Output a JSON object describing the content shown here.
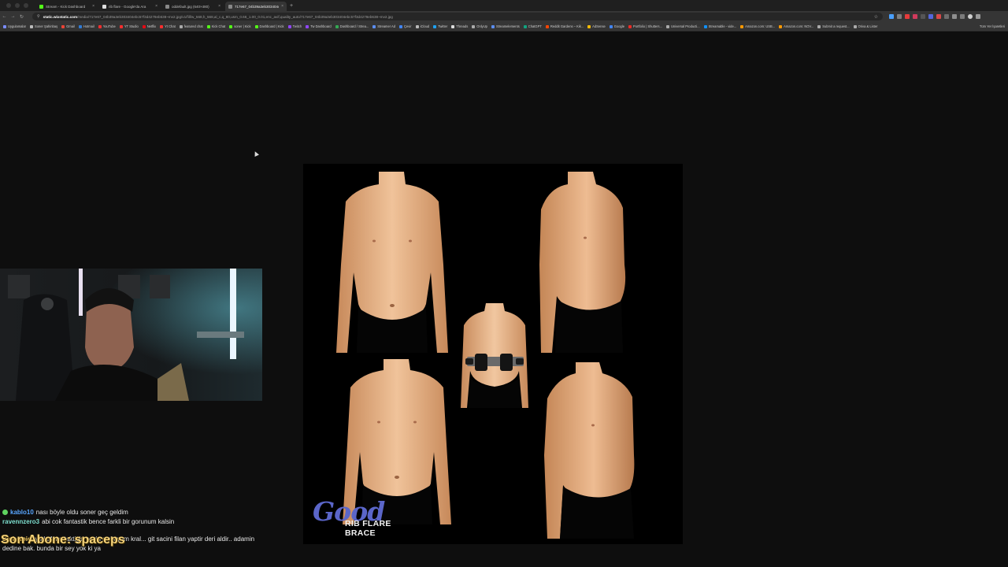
{
  "tabs": [
    {
      "label": "Stream - Kick Dashboard",
      "favicon_color": "#53fc18",
      "active": false
    },
    {
      "label": "rib flare - Google'da Ara",
      "favicon_color": "#dddddd",
      "active": false
    },
    {
      "label": "oddefault.jpg (640×480)",
      "favicon_color": "#888888",
      "active": false
    },
    {
      "label": "717e67_04b39a3eb303404c...",
      "favicon_color": "#888888",
      "active": true
    }
  ],
  "address": {
    "host": "static.wixstatic.com",
    "path": "/media/717e67_04b39a3eb303404ebc57f3d4278eb638~mv2.jpg/v1/fill/w_568,h_568,al_c,q_80,usm_0.66_1.00_0.01,enc_avif,quality_auto/717e67_04b39a3eb303404ebc57f3d4278eb638~mv2.jpg"
  },
  "bookmarks": [
    {
      "label": "Uygulamalar",
      "color": "#7a8cff"
    },
    {
      "label": "Soner Şahinbaş",
      "color": "#bbbbbb"
    },
    {
      "label": "Gmail",
      "color": "#ea4335"
    },
    {
      "label": "Hotmail",
      "color": "#2f7bd6"
    },
    {
      "label": "YouTube",
      "color": "#ff2d2d"
    },
    {
      "label": "YT Studio",
      "color": "#ff2d2d"
    },
    {
      "label": "Netflix",
      "color": "#e50914"
    },
    {
      "label": "Yt Chat",
      "color": "#ff2d2d"
    },
    {
      "label": "featured chat",
      "color": "#aaaaaa"
    },
    {
      "label": "Kick Chat",
      "color": "#53fc18"
    },
    {
      "label": "soner | Kick",
      "color": "#53fc18"
    },
    {
      "label": "Dashboard | Kick",
      "color": "#53fc18"
    },
    {
      "label": "Twitch",
      "color": "#9146ff"
    },
    {
      "label": "Tw Dashboard",
      "color": "#9146ff"
    },
    {
      "label": "Dashboard / Strea...",
      "color": "#34a853"
    },
    {
      "label": "Streamer Ad",
      "color": "#5b8def"
    },
    {
      "label": "Çevir",
      "color": "#4285f4"
    },
    {
      "label": "iCloud",
      "color": "#bbbbbb"
    },
    {
      "label": "Twitter",
      "color": "#1da1f2"
    },
    {
      "label": "Threads",
      "color": "#dddddd"
    },
    {
      "label": "OnlyUp",
      "color": "#aaaaaa"
    },
    {
      "label": "Streamelements",
      "color": "#5b8def"
    },
    {
      "label": "ChatGPT",
      "color": "#10a37f"
    },
    {
      "label": "Reddit Gardens – Kik...",
      "color": "#ff4500"
    },
    {
      "label": "AdSense",
      "color": "#fbbc05"
    },
    {
      "label": "Google",
      "color": "#4285f4"
    },
    {
      "label": "Portfolio | Shutters...",
      "color": "#ee2a24"
    },
    {
      "label": "Universal Producti...",
      "color": "#aaaaaa"
    },
    {
      "label": "Streamable - vide...",
      "color": "#0f90fa"
    },
    {
      "label": "Amazon.com: USB...",
      "color": "#ff9900"
    },
    {
      "label": "Amazon.com: NOV...",
      "color": "#ff9900"
    },
    {
      "label": "Submit a request...",
      "color": "#aaaaaa"
    },
    {
      "label": "Oriva & Lister",
      "color": "#aaaaaa"
    }
  ],
  "bookmarks_all": "Tüm Yer İşaretleri",
  "photo": {
    "brand_mark": "Good",
    "brand_caption": "RIB FLARE BRACE"
  },
  "chat": [
    {
      "user": "kablo10",
      "user_color": "#58a6ff",
      "badge": true,
      "message": "nası böyle oldu soner geç geldim"
    },
    {
      "user": "ravennzero3",
      "user_color": "#7ee0d0",
      "badge": false,
      "message": "abi cok fantastik bence farkli bir gorunum kalsin"
    },
    {
      "user": "Serhatpici",
      "user_color": "#f0c75e",
      "badge": false,
      "message": "ya kafana taktigin seyin awkoyum kral... git sacini filan yaptir deri aldir.. adamin dedine bak. bunda bir sey yok ki ya"
    }
  ],
  "sub_banner": {
    "label": "Son Abone:",
    "name": "spaceps"
  }
}
